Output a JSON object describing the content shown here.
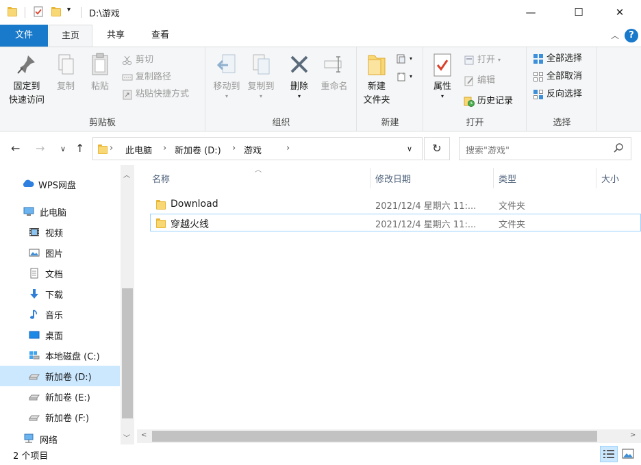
{
  "window": {
    "title": "D:\\游戏",
    "minimize": "—",
    "maximize": "☐",
    "close": "✕"
  },
  "tabs": {
    "file": "文件",
    "home": "主页",
    "share": "共享",
    "view": "查看"
  },
  "ribbon": {
    "clipboard": {
      "label": "剪贴板",
      "pin_line1": "固定到",
      "pin_line2": "快速访问",
      "copy": "复制",
      "paste": "粘贴",
      "cut": "剪切",
      "copy_path": "复制路径",
      "paste_shortcut": "粘贴快捷方式"
    },
    "organize": {
      "label": "组织",
      "move_to": "移动到",
      "copy_to": "复制到",
      "delete": "删除",
      "rename": "重命名"
    },
    "new": {
      "label": "新建",
      "new_folder_line1": "新建",
      "new_folder_line2": "文件夹"
    },
    "open": {
      "label": "打开",
      "properties": "属性",
      "open": "打开",
      "edit": "编辑",
      "history": "历史记录"
    },
    "select": {
      "label": "选择",
      "select_all": "全部选择",
      "select_none": "全部取消",
      "invert": "反向选择"
    }
  },
  "address": {
    "crumbs": [
      "此电脑",
      "新加卷 (D:)",
      "游戏"
    ],
    "search_placeholder": "搜索\"游戏\""
  },
  "nav": {
    "items": [
      {
        "label": "WPS网盘",
        "icon": "cloud-icon"
      },
      {
        "label": "此电脑",
        "icon": "computer-icon"
      },
      {
        "label": "视频",
        "icon": "video-icon"
      },
      {
        "label": "图片",
        "icon": "picture-icon"
      },
      {
        "label": "文档",
        "icon": "document-icon"
      },
      {
        "label": "下载",
        "icon": "download-icon"
      },
      {
        "label": "音乐",
        "icon": "music-icon"
      },
      {
        "label": "桌面",
        "icon": "desktop-icon"
      },
      {
        "label": "本地磁盘 (C:)",
        "icon": "system-drive-icon"
      },
      {
        "label": "新加卷 (D:)",
        "icon": "drive-icon"
      },
      {
        "label": "新加卷 (E:)",
        "icon": "drive-icon"
      },
      {
        "label": "新加卷 (F:)",
        "icon": "drive-icon"
      },
      {
        "label": "网络",
        "icon": "network-icon"
      }
    ]
  },
  "list": {
    "columns": {
      "name": "名称",
      "date": "修改日期",
      "type": "类型",
      "size": "大小"
    },
    "rows": [
      {
        "name": "Download",
        "date": "2021/12/4 星期六 11:...",
        "type": "文件夹"
      },
      {
        "name": "穿越火线",
        "date": "2021/12/4 星期六 11:...",
        "type": "文件夹"
      }
    ]
  },
  "status": {
    "count": "2 个项目"
  },
  "colors": {
    "accent": "#1979ca",
    "selection": "#cce8ff",
    "folder": "#f8d775"
  }
}
